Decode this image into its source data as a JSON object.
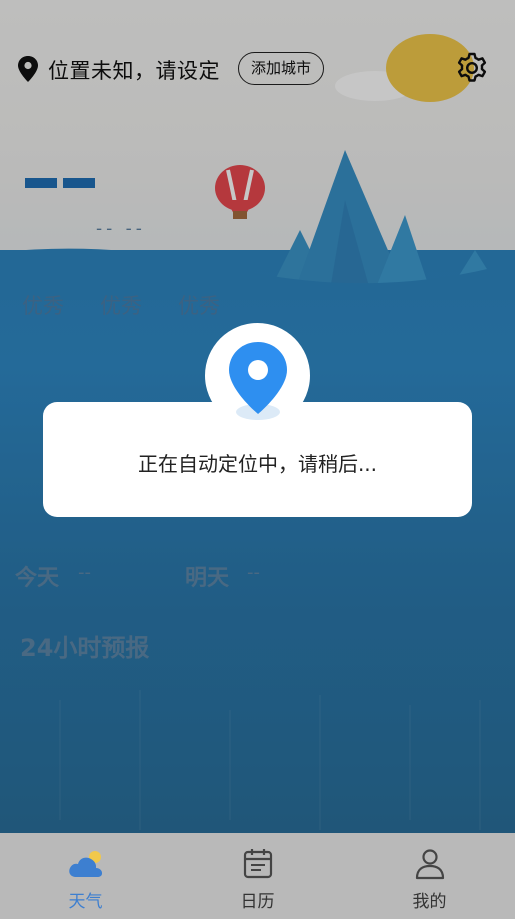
{
  "header": {
    "location_text": "位置未知，请设定",
    "add_city_label": "添加城市",
    "location_icon": "location-pin-icon",
    "settings_icon": "gear-icon"
  },
  "weather": {
    "sub_placeholder": "-- --",
    "aqi": [
      "优秀",
      "优秀",
      "优秀"
    ],
    "today_label": "今天",
    "today_value": "--",
    "tomorrow_label": "明天",
    "tomorrow_value": "--",
    "forecast_title": "24小时预报"
  },
  "dialog": {
    "message": "正在自动定位中，请稍后...",
    "icon": "location-pin-icon"
  },
  "nav": {
    "items": [
      {
        "label": "天气",
        "icon": "cloud-sun-icon",
        "active": true
      },
      {
        "label": "日历",
        "icon": "calendar-icon",
        "active": false
      },
      {
        "label": "我的",
        "icon": "user-icon",
        "active": false
      }
    ]
  },
  "colors": {
    "accent": "#3d7fd0",
    "pin_blue": "#2e8ff0",
    "sun": "#f1c84b",
    "sea": "#2e86c1"
  }
}
